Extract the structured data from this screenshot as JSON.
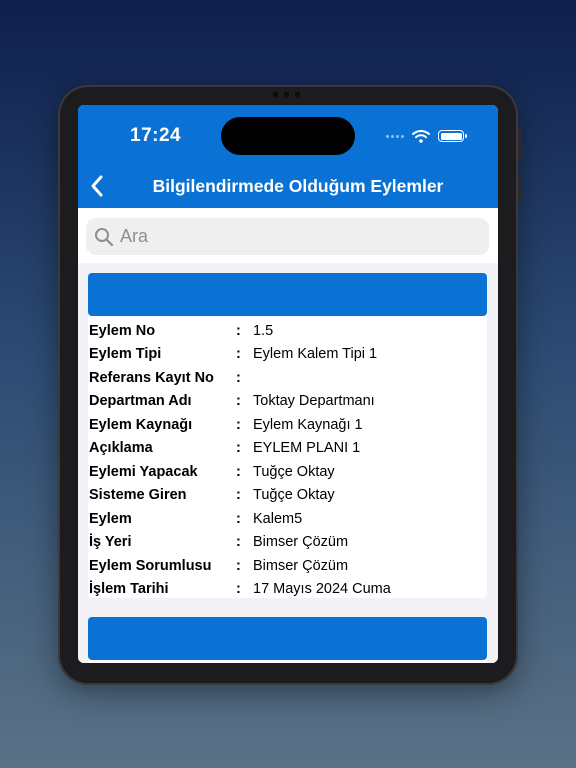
{
  "status_bar": {
    "time": "17:24"
  },
  "nav": {
    "title": "Bilgilendirmede Olduğum Eylemler"
  },
  "search": {
    "placeholder": "Ara"
  },
  "separator": ":",
  "record": {
    "fields": [
      {
        "label": "Eylem No",
        "value": "1.5"
      },
      {
        "label": "Eylem Tipi",
        "value": "Eylem Kalem Tipi 1"
      },
      {
        "label": "Referans Kayıt No",
        "value": ""
      },
      {
        "label": "Departman Adı",
        "value": "Toktay Departmanı"
      },
      {
        "label": "Eylem Kaynağı",
        "value": "Eylem Kaynağı 1"
      },
      {
        "label": "Açıklama",
        "value": "EYLEM PLANI 1"
      },
      {
        "label": "Eylemi Yapacak",
        "value": "Tuğçe Oktay"
      },
      {
        "label": "Sisteme Giren",
        "value": "Tuğçe Oktay"
      },
      {
        "label": "Eylem",
        "value": "Kalem5"
      },
      {
        "label": "İş Yeri",
        "value": "Bimser Çözüm"
      },
      {
        "label": "Eylem Sorumlusu",
        "value": "Bimser Çözüm"
      },
      {
        "label": "İşlem Tarihi",
        "value": "17 Mayıs 2024 Cuma"
      }
    ]
  },
  "colors": {
    "accent": "#0a72d4",
    "page_bg": "#f2f2f7"
  },
  "icons": {
    "back": "chevron-left-icon",
    "search": "search-icon",
    "wifi": "wifi-icon",
    "battery": "battery-icon"
  }
}
